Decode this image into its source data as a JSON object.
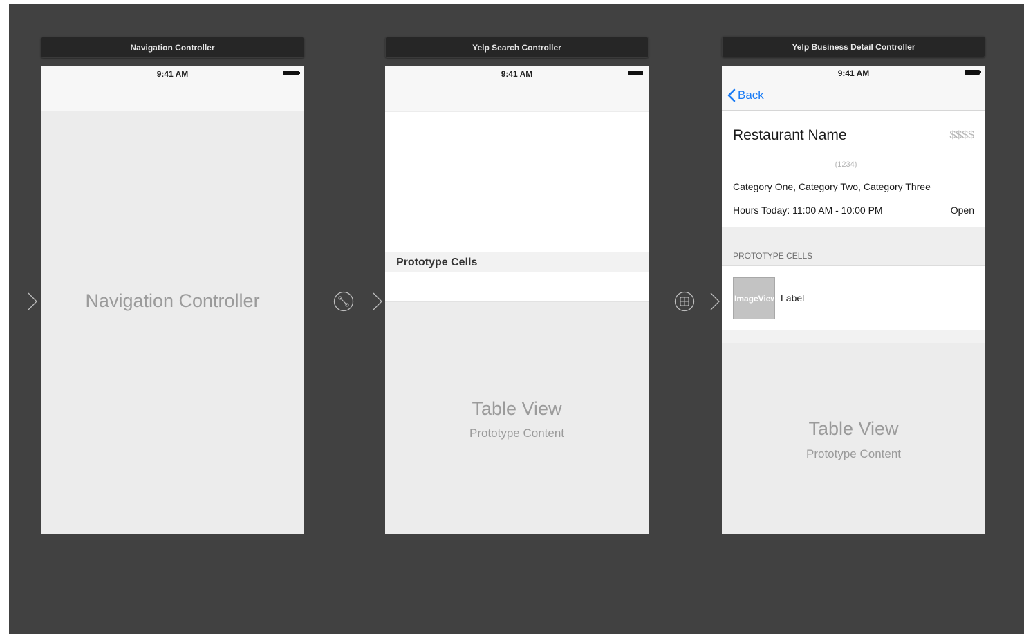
{
  "scenes": {
    "navigation": {
      "title": "Navigation Controller",
      "status_time": "9:41 AM",
      "placeholder": "Navigation Controller"
    },
    "search": {
      "title": "Yelp Search Controller",
      "status_time": "9:41 AM",
      "section_header": "Prototype Cells",
      "table_title": "Table View",
      "table_subtitle": "Prototype Content"
    },
    "detail": {
      "title": "Yelp Business Detail Controller",
      "status_time": "9:41 AM",
      "back_label": "Back",
      "restaurant_name": "Restaurant Name",
      "price": "$$$$",
      "review_count": "(1234)",
      "categories": "Category One, Category Two, Category Three",
      "hours": "Hours Today: 11:00 AM - 10:00 PM",
      "open_status": "Open",
      "section_header": "PROTOTYPE CELLS",
      "image_view_label": "ImageView",
      "cell_label": "Label",
      "table_title": "Table View",
      "table_subtitle": "Prototype Content"
    }
  },
  "segues": {
    "root_icon": "relationship-segue-icon",
    "show_icon": "show-segue-icon"
  },
  "colors": {
    "canvas": "#414141",
    "title_bar": "#262626",
    "placeholder_text": "#9b9b9b",
    "ios_blue": "#1a7cf5",
    "connector": "#bdbdbd"
  }
}
